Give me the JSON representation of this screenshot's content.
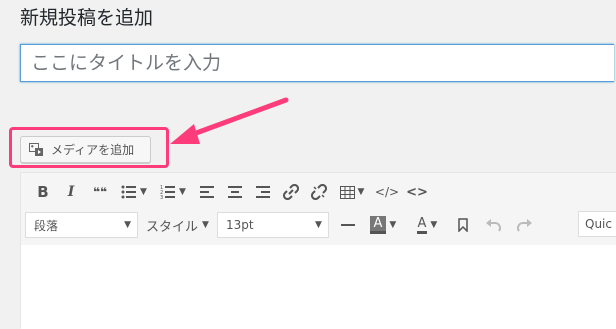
{
  "page": {
    "title": "新規投稿を追加"
  },
  "title_field": {
    "placeholder": "ここにタイトルを入力"
  },
  "media": {
    "button_label": "メディアを追加"
  },
  "toolbar": {
    "row1": {
      "bold": "B",
      "italic": "I",
      "blockquote": "❝❝",
      "code": "</>",
      "embed": "<>"
    },
    "row2": {
      "format_select": "段落",
      "style_dropdown": "スタイル",
      "font_size": "13pt",
      "text_color_letter": "A",
      "bg_color_letter": "A",
      "quick_label": "Quic"
    }
  },
  "colors": {
    "accent": "#ff3c7b",
    "focus": "#5b9dd9"
  }
}
